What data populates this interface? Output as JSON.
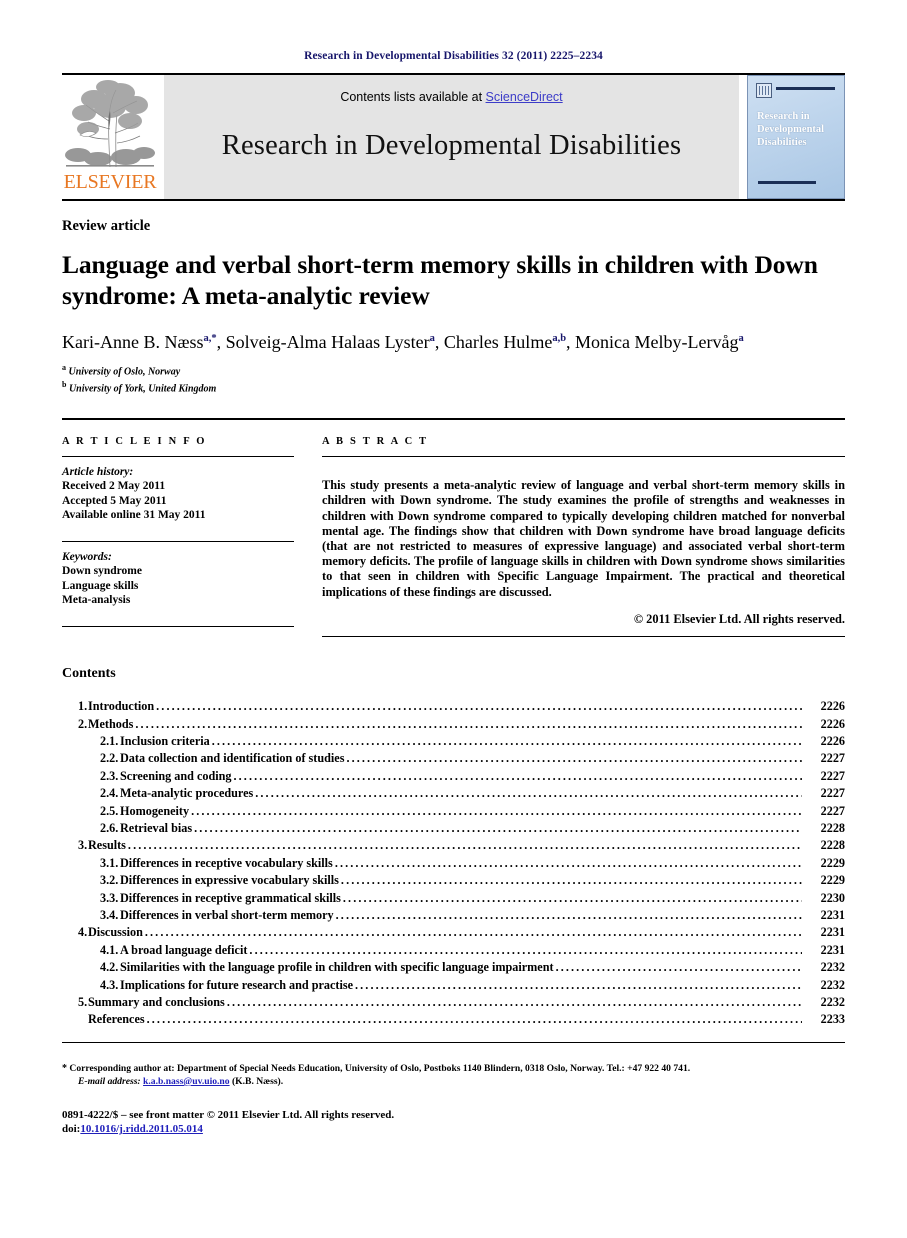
{
  "running_head": "Research in Developmental Disabilities 32 (2011) 2225–2234",
  "masthead": {
    "publisher": "ELSEVIER",
    "contents_line_prefix": "Contents lists available at ",
    "sciencedirect": "ScienceDirect",
    "journal_name": "Research in Developmental Disabilities",
    "cover_title": "Research in Developmental Disabilities",
    "colors": {
      "running_head": "#17166b",
      "elsevier_orange": "#e87722",
      "sciencedirect_blue": "#3c3cc8",
      "banner_gray": "#e4e4e4",
      "cover_blue": "#bdd4ec"
    }
  },
  "article": {
    "type": "Review article",
    "title": "Language and verbal short-term memory skills in children with Down syndrome: A meta-analytic review",
    "authors": "Kari-Anne B. Næss a,*, Solveig-Alma Halaas Lyster a, Charles Hulme a,b, Monica Melby-Lervåg a",
    "author_list": [
      {
        "name": "Kari-Anne B. Næss",
        "marks": "a,*"
      },
      {
        "name": "Solveig-Alma Halaas Lyster",
        "marks": "a"
      },
      {
        "name": "Charles Hulme",
        "marks": "a,b"
      },
      {
        "name": "Monica Melby-Lervåg",
        "marks": "a"
      }
    ],
    "affiliations": [
      {
        "mark": "a",
        "text": "University of Oslo, Norway"
      },
      {
        "mark": "b",
        "text": "University of York, United Kingdom"
      }
    ]
  },
  "article_info": {
    "heading": "A R T I C L E   I N F O",
    "history_label": "Article history:",
    "history": [
      "Received 2 May 2011",
      "Accepted 5 May 2011",
      "Available online 31 May 2011"
    ],
    "keywords_label": "Keywords:",
    "keywords": [
      "Down syndrome",
      "Language skills",
      "Meta-analysis"
    ]
  },
  "abstract": {
    "heading": "A B S T R A C T",
    "text": "This study presents a meta-analytic review of language and verbal short-term memory skills in children with Down syndrome. The study examines the profile of strengths and weaknesses in children with Down syndrome compared to typically developing children matched for nonverbal mental age. The findings show that children with Down syndrome have broad language deficits (that are not restricted to measures of expressive language) and associated verbal short-term memory deficits. The profile of language skills in children with Down syndrome shows similarities to that seen in children with Specific Language Impairment. The practical and theoretical implications of these findings are discussed.",
    "copyright": "© 2011 Elsevier Ltd. All rights reserved."
  },
  "contents": {
    "heading": "Contents",
    "entries": [
      {
        "num": "1.",
        "label": "Introduction",
        "page": "2226",
        "level": 1
      },
      {
        "num": "2.",
        "label": "Methods",
        "page": "2226",
        "level": 1
      },
      {
        "num": "2.1.",
        "label": "Inclusion criteria",
        "page": "2226",
        "level": 2
      },
      {
        "num": "2.2.",
        "label": "Data collection and identification of studies",
        "page": "2227",
        "level": 2
      },
      {
        "num": "2.3.",
        "label": "Screening and coding",
        "page": "2227",
        "level": 2
      },
      {
        "num": "2.4.",
        "label": "Meta-analytic procedures",
        "page": "2227",
        "level": 2
      },
      {
        "num": "2.5.",
        "label": "Homogeneity",
        "page": "2227",
        "level": 2
      },
      {
        "num": "2.6.",
        "label": "Retrieval bias",
        "page": "2228",
        "level": 2
      },
      {
        "num": "3.",
        "label": "Results",
        "page": "2228",
        "level": 1
      },
      {
        "num": "3.1.",
        "label": "Differences in receptive vocabulary skills",
        "page": "2229",
        "level": 2
      },
      {
        "num": "3.2.",
        "label": "Differences in expressive vocabulary skills",
        "page": "2229",
        "level": 2
      },
      {
        "num": "3.3.",
        "label": "Differences in receptive grammatical skills",
        "page": "2230",
        "level": 2
      },
      {
        "num": "3.4.",
        "label": "Differences in verbal short-term memory",
        "page": "2231",
        "level": 2
      },
      {
        "num": "4.",
        "label": "Discussion",
        "page": "2231",
        "level": 1
      },
      {
        "num": "4.1.",
        "label": "A broad language deficit",
        "page": "2231",
        "level": 2
      },
      {
        "num": "4.2.",
        "label": "Similarities with the language profile in children with specific language impairment",
        "page": "2232",
        "level": 2
      },
      {
        "num": "4.3.",
        "label": "Implications for future research and practise",
        "page": "2232",
        "level": 2
      },
      {
        "num": "5.",
        "label": "Summary and conclusions",
        "page": "2232",
        "level": 1
      },
      {
        "num": "",
        "label": "References",
        "page": "2233",
        "level": 1
      }
    ]
  },
  "footer": {
    "corresponding_marker": "*",
    "corresponding_text": "Corresponding author at: Department of Special Needs Education, University of Oslo, Postboks 1140 Blindern, 0318 Oslo, Norway. Tel.: +47 922 40 741.",
    "email_label": "E-mail address:",
    "email": "k.a.b.nass@uv.uio.no",
    "email_owner": "(K.B. Næss).",
    "issn_line": "0891-4222/$ – see front matter © 2011 Elsevier Ltd. All rights reserved.",
    "doi_label": "doi:",
    "doi": "10.1016/j.ridd.2011.05.014"
  }
}
